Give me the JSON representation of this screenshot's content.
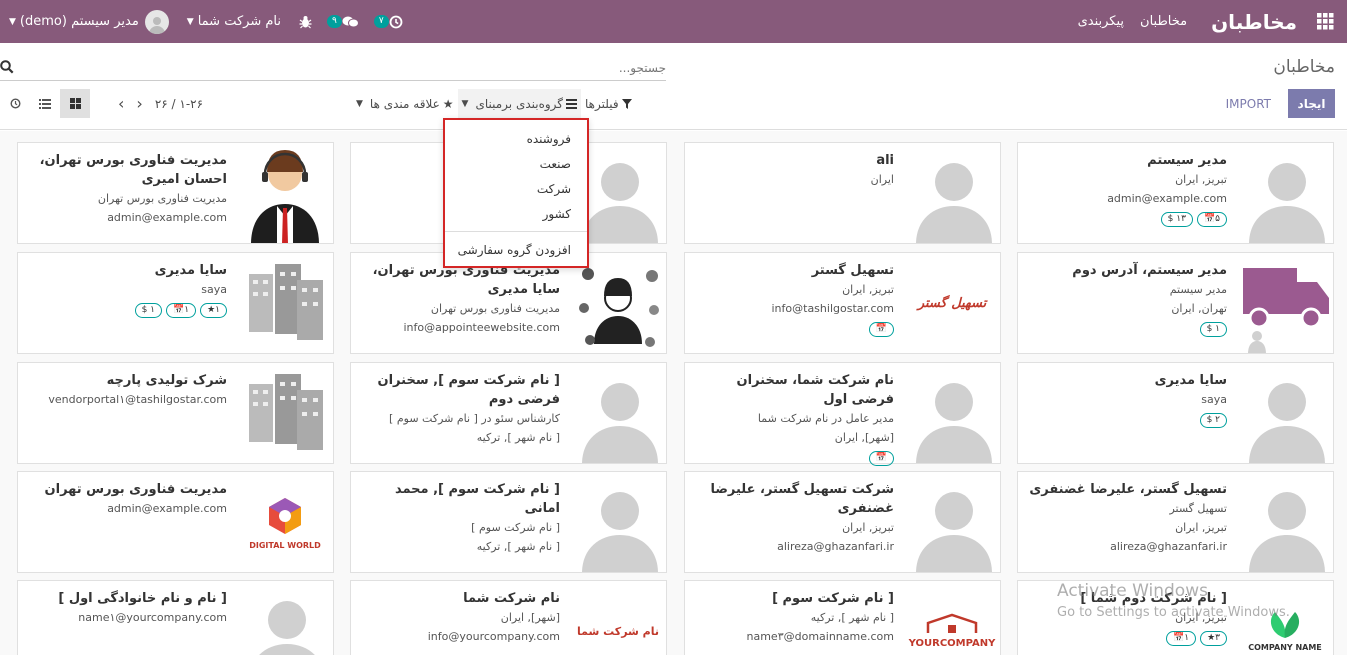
{
  "navbar": {
    "brand": "مخاطبان",
    "menu": [
      "مخاطبان",
      "پیکربندی"
    ],
    "activity_badge": "۷",
    "messages_badge": "۹",
    "company": "نام شرکت شما",
    "user": "مدیر سیستم (demo)",
    "icons": [
      "apps-grid-icon",
      "clock-icon",
      "chat-icon",
      "bug-icon",
      "user-avatar-icon"
    ]
  },
  "control_panel": {
    "title": "مخاطبان",
    "search_placeholder": "جستجو...",
    "create_label": "ایجاد",
    "import_label": "IMPORT",
    "filters_label": "فیلترها",
    "groupby_label": "گروه‌بندی برمبنای",
    "favorites_label": "علاقه مندی ها",
    "pager_value": "۱-۲۶ / ۲۶",
    "views": [
      "kanban-view-icon",
      "list-view-icon",
      "activity-view-icon"
    ]
  },
  "groupby_menu": {
    "items": [
      "فروشنده",
      "صنعت",
      "شرکت",
      "کشور"
    ],
    "custom_label": "افزودن گروه سفارشی"
  },
  "cards": [
    {
      "name": "مدیر سیستم",
      "lines": [
        "تبریز, ایران",
        "admin@example.com"
      ],
      "tags": [
        "۵📅",
        "۱۳ $"
      ],
      "img": "placeholder"
    },
    {
      "name": "ali",
      "lines": [
        "ایران"
      ],
      "tags": [],
      "img": "placeholder"
    },
    {
      "name": "",
      "lines": [],
      "tags": [],
      "img": "placeholder"
    },
    {
      "name": "مدیریت فناوری بورس تهران، احسان امیری",
      "lines": [
        "مدیریت فناوری بورس تهران",
        "admin@example.com"
      ],
      "tags": [],
      "img": "operator"
    },
    {
      "name": "مدیر سیستم، آدرس دوم",
      "lines": [
        "مدیر سیستم",
        "تهران, ایران"
      ],
      "tags": [
        "۱ $"
      ],
      "img": "truck"
    },
    {
      "name": "تسهیل گستر",
      "lines": [
        "تبریز, ایران",
        "info@tashilgostar.com"
      ],
      "tags": [
        "📅"
      ],
      "img": "tashil"
    },
    {
      "name": "مدیریت فناوری بورس تهران، سایا مدیری",
      "lines": [
        "مدیریت فناوری بورس تهران",
        "info@appointeewebsite.com"
      ],
      "tags": [],
      "img": "operator2"
    },
    {
      "name": "سایا مدیری",
      "lines": [
        "saya"
      ],
      "tags": [
        "۱★",
        "۱📅",
        "۱ $"
      ],
      "img": "buildings"
    },
    {
      "name": "سایا مدیری",
      "lines": [
        "saya"
      ],
      "tags": [
        "۲ $"
      ],
      "img": "placeholder"
    },
    {
      "name": "نام شرکت شما، سخنران فرضی اول",
      "lines": [
        "مدیر عامل در نام شرکت شما",
        "[شهر], ایران"
      ],
      "tags": [
        "📅"
      ],
      "img": "ph-logo-shoma"
    },
    {
      "name": "[ نام شرکت سوم ], سخنران فرضی دوم",
      "lines": [
        "کارشناس سئو در [ نام شرکت سوم ]",
        "[ نام شهر ], ترکیه"
      ],
      "tags": [],
      "img": "ph-logo-your"
    },
    {
      "name": "شرک تولیدی پارچه",
      "lines": [
        "vendorportal۱@tashilgostar.com"
      ],
      "tags": [],
      "img": "buildings"
    },
    {
      "name": "تسهیل گستر، علیرضا غضنفری",
      "lines": [
        "تسهیل گستر",
        "تبریز, ایران",
        "alireza@ghazanfari.ir"
      ],
      "tags": [],
      "img": "ph-small"
    },
    {
      "name": "شرکت تسهیل گستر، علیرضا غضنفری",
      "lines": [
        "تبریز, ایران",
        "alireza@ghazanfari.ir"
      ],
      "tags": [],
      "img": "placeholder"
    },
    {
      "name": "[ نام شرکت سوم ], محمد امانی",
      "lines": [
        "[ نام شرکت سوم ]",
        "[ نام شهر ], ترکیه"
      ],
      "tags": [],
      "img": "ph-logo-your"
    },
    {
      "name": "مدیریت فناوری بورس تهران",
      "lines": [
        "admin@example.com"
      ],
      "tags": [],
      "img": "digital"
    },
    {
      "name": "[ نام شرکت دوم شما ]",
      "lines": [
        "تبریز, ایران"
      ],
      "tags": [
        "۳★",
        "۱📅"
      ],
      "img": "leaf"
    },
    {
      "name": "[ نام شرکت سوم ]",
      "lines": [
        "[ نام شهر ], ترکیه",
        "name۳@domainname.com"
      ],
      "tags": [],
      "img": "yourcompany"
    },
    {
      "name": "نام شرکت شما",
      "lines": [
        "[شهر], ایران",
        "info@yourcompany.com"
      ],
      "tags": [],
      "img": "shoma"
    },
    {
      "name": "[ نام و نام خانوادگی اول ]",
      "lines": [
        "name۱@yourcompany.com"
      ],
      "tags": [],
      "img": "placeholder"
    }
  ],
  "logo_texts": {
    "tashil": "تسهیل گستر",
    "shoma": "نام شرکت شما",
    "your": "YOURCOMPANY",
    "digital": "DIGITAL WORLD",
    "leaf": "COMPANY NAME"
  },
  "watermark": {
    "line1": "Activate Windows",
    "line2": "Go to Settings to activate Windows."
  }
}
